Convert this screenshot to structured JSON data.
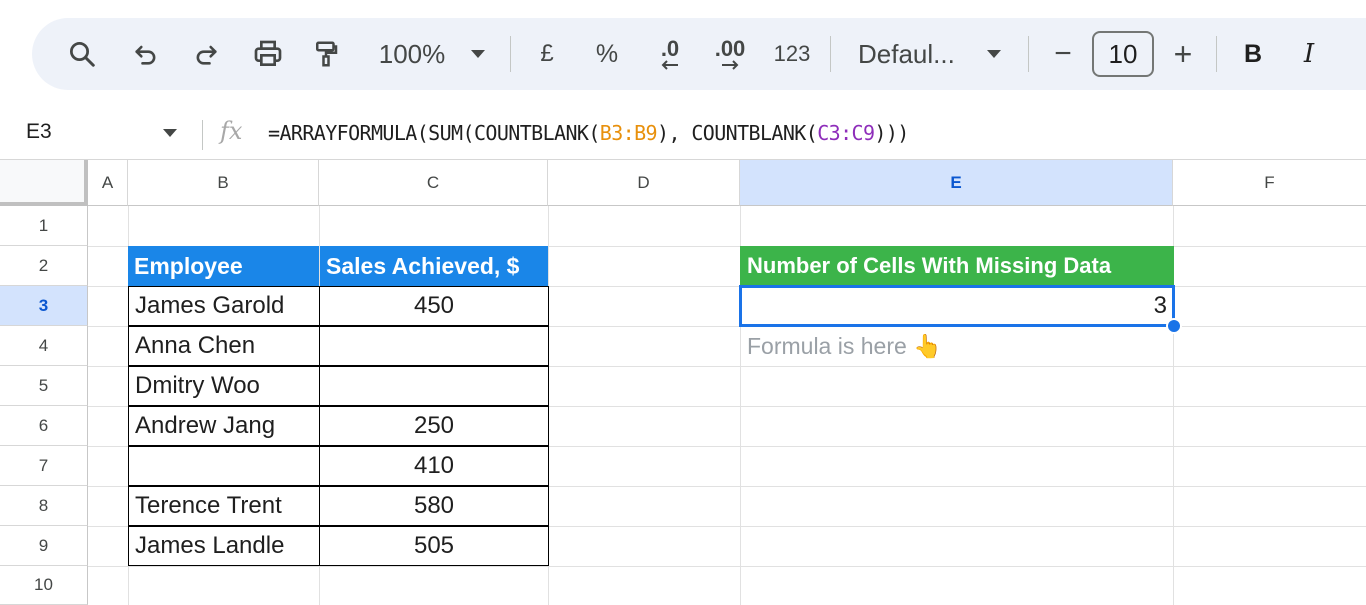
{
  "toolbar": {
    "zoom": "100%",
    "currency": "£",
    "percent": "%",
    "decrease_decimals": ".0",
    "increase_decimals": ".00",
    "number_format": "123",
    "font_family": "Defaul...",
    "font_size": "10",
    "minus": "−",
    "plus": "+",
    "bold": "B",
    "italic": "I"
  },
  "formula_bar": {
    "cell_ref": "E3",
    "fx": "fx",
    "formula_parts": [
      "=ARRAYFORMULA(SUM(COUNTBLANK(",
      "B3:B9",
      "), COUNTBLANK(",
      "C3:C9",
      ")))"
    ]
  },
  "columns": [
    "A",
    "B",
    "C",
    "D",
    "E",
    "F"
  ],
  "rows": [
    "1",
    "2",
    "3",
    "4",
    "5",
    "6",
    "7",
    "8",
    "9",
    "10"
  ],
  "selected_column": "E",
  "selected_row": "3",
  "table": {
    "headers": [
      "Employee",
      "Sales Achieved, $"
    ],
    "rows": [
      [
        "James Garold",
        "450"
      ],
      [
        "Anna Chen",
        ""
      ],
      [
        "Dmitry Woo",
        ""
      ],
      [
        "Andrew Jang",
        "250"
      ],
      [
        "",
        "410"
      ],
      [
        "Terence Trent",
        "580"
      ],
      [
        "James Landle",
        "505"
      ]
    ]
  },
  "result": {
    "header": "Number of Cells With Missing Data",
    "value": "3",
    "note": "Formula is here 👆"
  },
  "colors": {
    "table_header": "#1a86e8",
    "result_header": "#3cb44a",
    "selection": "#1a73e8",
    "toolbar_bg": "#eef2f9"
  }
}
